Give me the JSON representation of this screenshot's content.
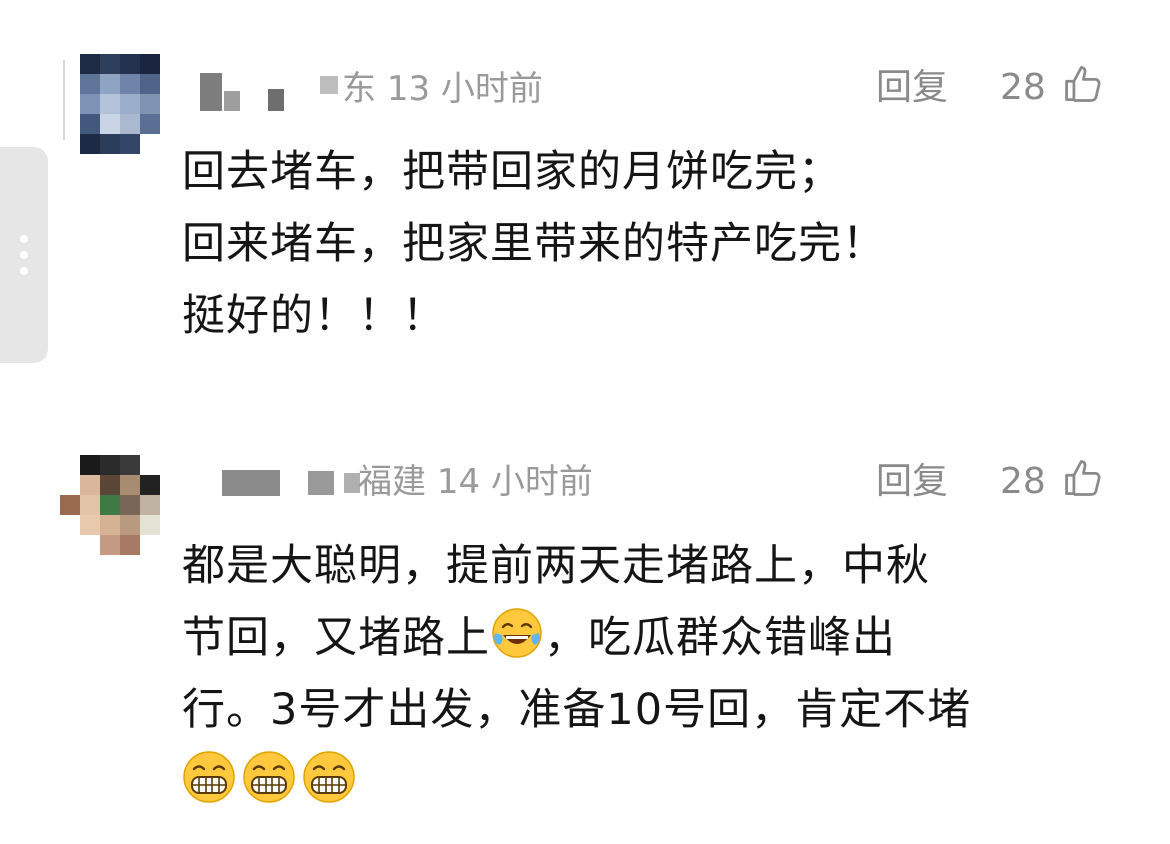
{
  "comments": [
    {
      "location": "东",
      "time": "13 小时前",
      "reply_label": "回复",
      "likes": "28",
      "lines": [
        "回去堵车，把带回家的月饼吃完；",
        "回来堵车，把家里带来的特产吃完！",
        "挺好的！！！"
      ]
    },
    {
      "location": "福建",
      "time": "14 小时前",
      "reply_label": "回复",
      "likes": "28",
      "lines": [
        "都是大聪明，提前两天走堵路上，中秋",
        "节回，又堵路上",
        "，吃瓜群众错峰出",
        "行。3号才出发，准备10号回，肯定不堵"
      ]
    }
  ],
  "icons": {
    "like": "thumbs-up-icon",
    "laugh_emoji": "tears-of-joy-emoji",
    "grin_emoji": "grinning-face-emoji",
    "menu": "vertical-dots-icon"
  },
  "colors": {
    "text": "#151515",
    "meta": "#9a9a9a",
    "action": "#8a8a8a",
    "emoji_yellow": "#ffc83d"
  }
}
